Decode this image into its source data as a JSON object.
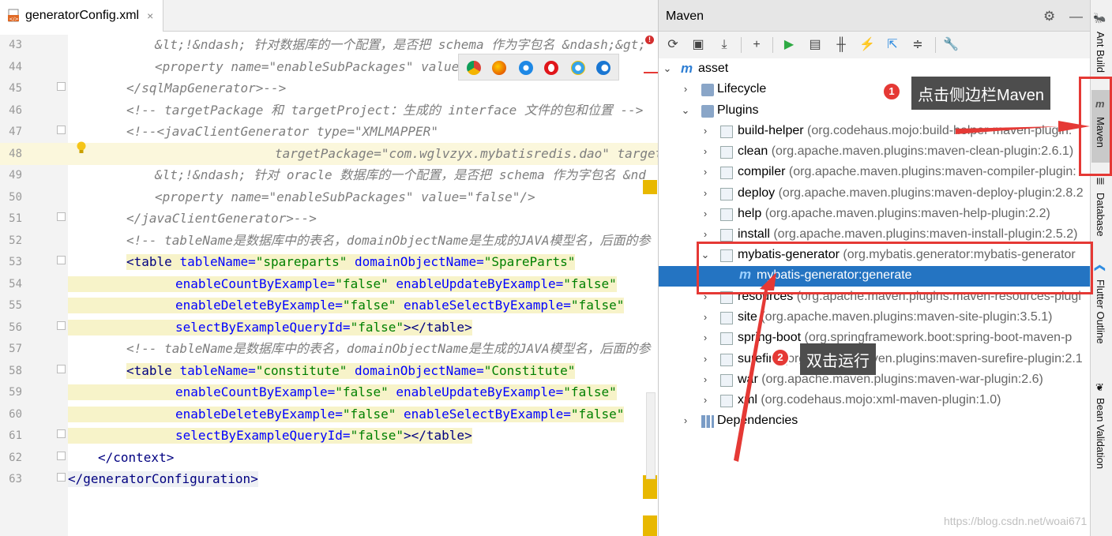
{
  "editor": {
    "tab_label": "generatorConfig.xml",
    "tab_close": "×",
    "line_numbers": [
      "43",
      "44",
      "45",
      "46",
      "47",
      "48",
      "49",
      "50",
      "51",
      "52",
      "53",
      "54",
      "55",
      "56",
      "57",
      "58",
      "59",
      "60",
      "61",
      "62",
      "63"
    ],
    "lines": {
      "l43": "&lt;!&ndash; 针对数据库的一个配置，是否把 schema 作为字包名 &ndash;&gt;",
      "l44_a": "<property ",
      "l44_b": "name=\"enableSubPackages\" ",
      "l44_c": "value=\"fa",
      "l45": "</sqlMapGenerator>-->",
      "l46": "<!-- targetPackage 和 targetProject：生成的 interface 文件的包和位置 -->",
      "l47": "<!--<javaClientGenerator type=\"XMLMAPPER\"",
      "l48": "targetPackage=\"com.wglvzyx.mybatisredis.dao\" targetPro",
      "l49": "&lt;!&ndash; 针对 oracle 数据库的一个配置，是否把 schema 作为字包名 &nd",
      "l50": "<property name=\"enableSubPackages\" value=\"false\"/>",
      "l51": "</javaClientGenerator>-->",
      "l52": "<!-- tableName是数据库中的表名，domainObjectName是生成的JAVA模型名，后面的参",
      "l53_tag": "<table ",
      "l53_a1": "tableName=",
      "l53_v1": "\"spareparts\"",
      "l53_a2": " domainObjectName=",
      "l53_v2": "\"SpareParts\"",
      "l54_a1": "enableCountByExample=",
      "l54_v1": "\"false\"",
      "l54_a2": " enableUpdateByExample=",
      "l54_v2": "\"false\"",
      "l55_a1": "enableDeleteByExample=",
      "l55_v1": "\"false\"",
      "l55_a2": " enableSelectByExample=",
      "l55_v2": "\"false\"",
      "l56_a1": "selectByExampleQueryId=",
      "l56_v1": "\"false\"",
      "l56_t": "></table>",
      "l57": "<!-- tableName是数据库中的表名，domainObjectName是生成的JAVA模型名，后面的参",
      "l58_tag": "<table ",
      "l58_a1": "tableName=",
      "l58_v1": "\"constitute\"",
      "l58_a2": " domainObjectName=",
      "l58_v2": "\"Constitute\"",
      "l59_a1": "enableCountByExample=",
      "l59_v1": "\"false\"",
      "l59_a2": " enableUpdateByExample=",
      "l59_v2": "\"false\"",
      "l60_a1": "enableDeleteByExample=",
      "l60_v1": "\"false\"",
      "l60_a2": " enableSelectByExample=",
      "l60_v2": "\"false\"",
      "l61_a1": "selectByExampleQueryId=",
      "l61_v1": "\"false\"",
      "l61_t": "></table>",
      "l62": "</context>",
      "l63": "</generatorConfiguration>"
    },
    "warning_badge": "!"
  },
  "maven": {
    "title": "Maven",
    "tree": {
      "root": "asset",
      "lifecycle": "Lifecycle",
      "plugins": "Plugins",
      "items": [
        {
          "name": "build-helper",
          "coord": " (org.codehaus.mojo:build-helper-maven-plugin:"
        },
        {
          "name": "clean",
          "coord": " (org.apache.maven.plugins:maven-clean-plugin:2.6.1)"
        },
        {
          "name": "compiler",
          "coord": " (org.apache.maven.plugins:maven-compiler-plugin:"
        },
        {
          "name": "deploy",
          "coord": " (org.apache.maven.plugins:maven-deploy-plugin:2.8.2"
        },
        {
          "name": "help",
          "coord": " (org.apache.maven.plugins:maven-help-plugin:2.2)"
        },
        {
          "name": "install",
          "coord": " (org.apache.maven.plugins:maven-install-plugin:2.5.2)"
        },
        {
          "name": "mybatis-generator",
          "coord": " (org.mybatis.generator:mybatis-generator"
        },
        {
          "name": "resources",
          "coord": " (org.apache.maven.plugins:maven-resources-plugi"
        },
        {
          "name": "site",
          "coord": " (org.apache.maven.plugins:maven-site-plugin:3.5.1)"
        },
        {
          "name": "spring-boot",
          "coord": " (org.springframework.boot:spring-boot-maven-p"
        },
        {
          "name": "surefire",
          "coord": " (org.apache.maven.plugins:maven-surefire-plugin:2.1"
        },
        {
          "name": "war",
          "coord": " (org.apache.maven.plugins:maven-war-plugin:2.6)"
        },
        {
          "name": "xml",
          "coord": " (org.codehaus.mojo:xml-maven-plugin:1.0)"
        }
      ],
      "goal": "mybatis-generator:generate",
      "dependencies": "Dependencies"
    }
  },
  "stripe": {
    "ant": "Ant Build",
    "maven": "Maven",
    "database": "Database",
    "flutter": "Flutter Outline",
    "bean": "Bean Validation"
  },
  "annotations": {
    "badge1": "1",
    "callout1": "点击侧边栏Maven",
    "badge2": "2",
    "callout2": "双击运行"
  },
  "watermark": "https://blog.csdn.net/woai671",
  "colors": {
    "selection": "#2474c2",
    "annotation_red": "#e53935",
    "callout_bg": "#4d4d4d"
  }
}
